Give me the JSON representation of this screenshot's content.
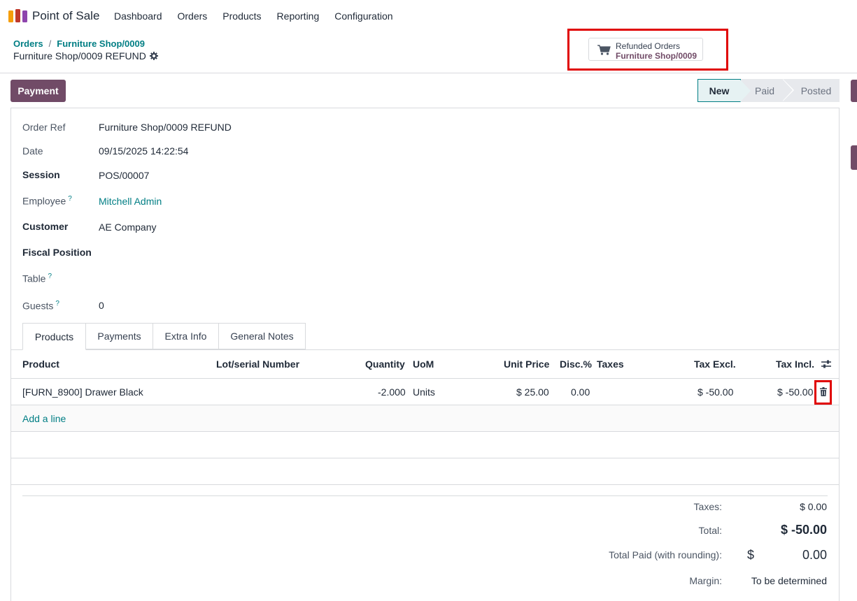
{
  "navbar": {
    "app_name": "Point of Sale",
    "menu": [
      "Dashboard",
      "Orders",
      "Products",
      "Reporting",
      "Configuration"
    ]
  },
  "breadcrumb": {
    "parent": "Orders",
    "sep": "/",
    "current": "Furniture Shop/0009"
  },
  "record": {
    "title": "Furniture Shop/0009 REFUND"
  },
  "smart_button": {
    "label": "Refunded Orders",
    "value": "Furniture Shop/0009"
  },
  "actions": {
    "payment_label": "Payment"
  },
  "statusbar": [
    "New",
    "Paid",
    "Posted"
  ],
  "fields": {
    "order_ref": {
      "label": "Order Ref",
      "value": "Furniture Shop/0009 REFUND"
    },
    "date": {
      "label": "Date",
      "value": "09/15/2025 14:22:54"
    },
    "session": {
      "label": "Session",
      "value": "POS/00007"
    },
    "employee": {
      "label": "Employee",
      "help": "?",
      "value": "Mitchell Admin"
    },
    "customer": {
      "label": "Customer",
      "value": "AE Company"
    },
    "fiscal_position": {
      "label": "Fiscal Position",
      "value": ""
    },
    "table": {
      "label": "Table",
      "help": "?",
      "value": ""
    },
    "guests": {
      "label": "Guests",
      "help": "?",
      "value": "0"
    }
  },
  "tabs": [
    "Products",
    "Payments",
    "Extra Info",
    "General Notes"
  ],
  "table": {
    "headers": {
      "product": "Product",
      "lot": "Lot/serial Number",
      "quantity": "Quantity",
      "uom": "UoM",
      "unit_price": "Unit Price",
      "disc": "Disc.%",
      "taxes": "Taxes",
      "tax_excl": "Tax Excl.",
      "tax_incl": "Tax Incl."
    },
    "rows": [
      {
        "product": "[FURN_8900] Drawer Black",
        "lot": "",
        "quantity": "-2.000",
        "uom": "Units",
        "unit_price": "$ 25.00",
        "disc": "0.00",
        "taxes": "",
        "tax_excl": "$ -50.00",
        "tax_incl": "$ -50.00"
      }
    ],
    "add_line": "Add a line"
  },
  "totals": {
    "taxes_label": "Taxes:",
    "taxes_value": "$ 0.00",
    "total_label": "Total:",
    "total_value": "$ -50.00",
    "paid_label": "Total Paid (with rounding):",
    "paid_currency": "$",
    "paid_value": "0.00",
    "margin_label": "Margin:",
    "margin_value": "To be determined"
  },
  "colors": {
    "brand": "#714b67",
    "accent": "#017e84",
    "highlight": "#e00000"
  }
}
